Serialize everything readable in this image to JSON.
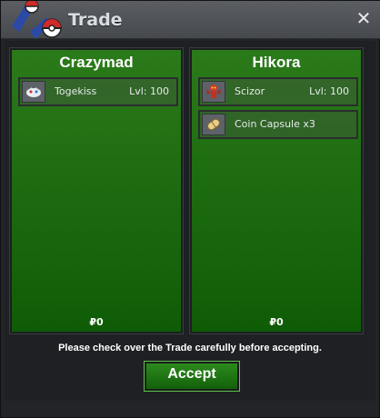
{
  "window": {
    "title": "Trade"
  },
  "left": {
    "player": "Crazymad",
    "items": [
      {
        "name": "Togekiss",
        "level": "Lvl: 100",
        "icon": "togekiss-icon"
      }
    ],
    "money": "₽0"
  },
  "right": {
    "player": "Hikora",
    "items": [
      {
        "name": "Scizor",
        "level": "Lvl: 100",
        "icon": "scizor-icon"
      },
      {
        "name": "Coin Capsule x3",
        "level": "",
        "icon": "coin-capsule-icon"
      }
    ],
    "money": "₽0"
  },
  "footer": {
    "notice": "Please check over the Trade carefully before accepting.",
    "accept_label": "Accept"
  },
  "colors": {
    "panel_green": "#1c6b10",
    "accept_green": "#2c8a1d"
  }
}
